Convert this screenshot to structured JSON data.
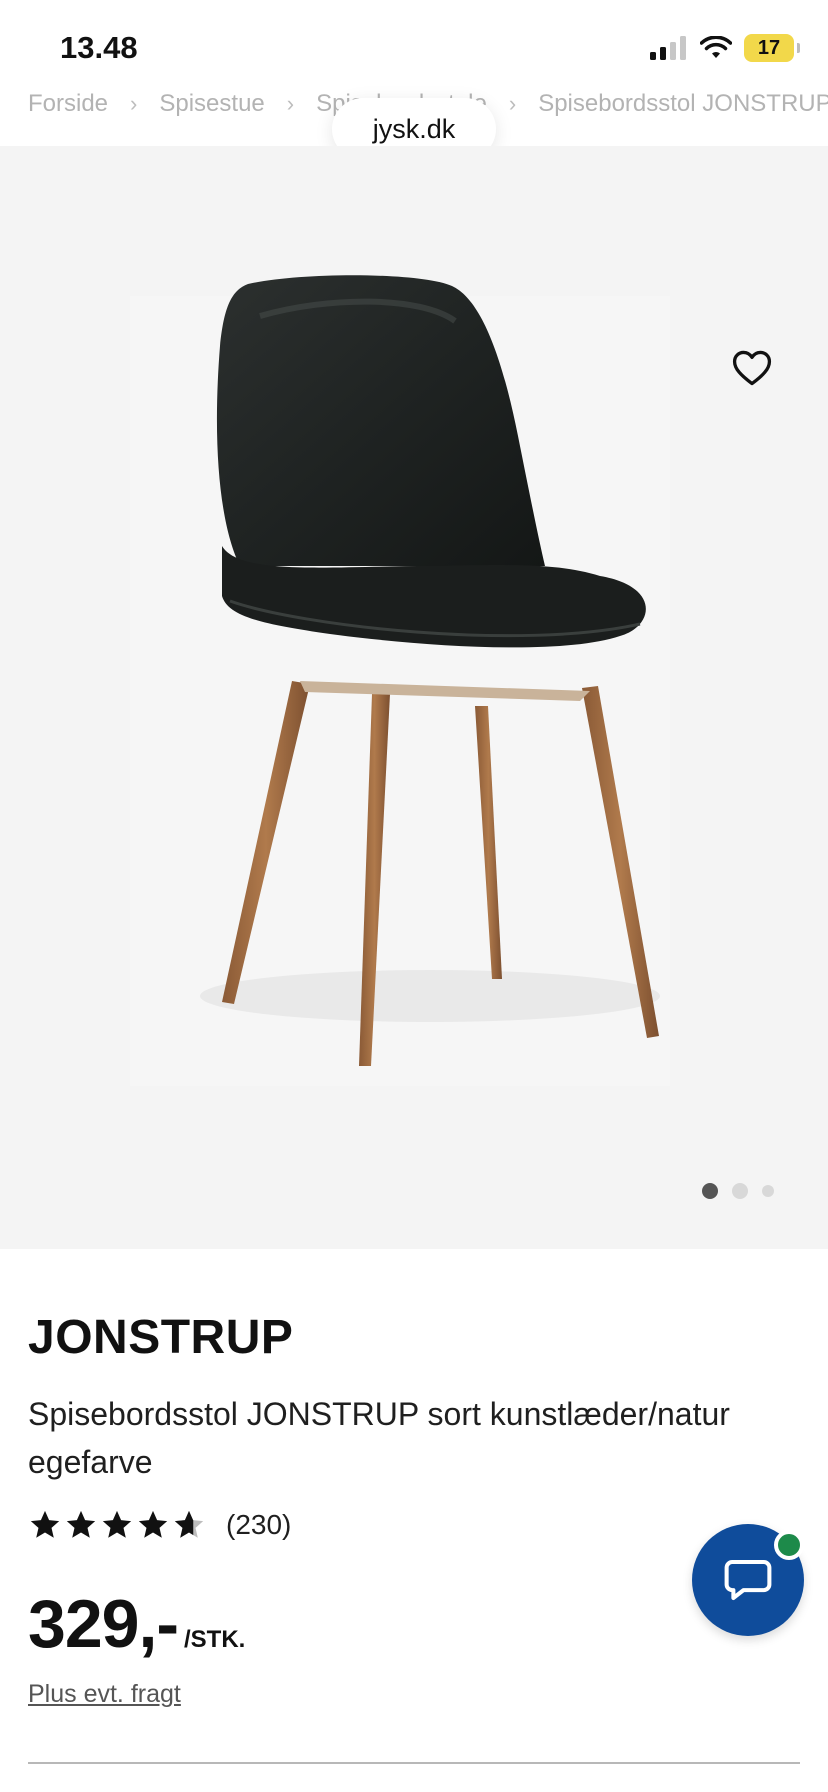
{
  "status_bar": {
    "time": "13.48",
    "battery": "17"
  },
  "breadcrumb": {
    "items": [
      "Forside",
      "Spisestue",
      "Spisebordsstole",
      "Spisebordsstol JONSTRUP"
    ]
  },
  "browser": {
    "url": "jysk.dk"
  },
  "gallery": {
    "image_count": 3,
    "active_index": 0
  },
  "product": {
    "name": "JONSTRUP",
    "description": "Spisebordsstol JONSTRUP sort kunstlæder/natur egefarve",
    "rating": {
      "stars": 4.5,
      "count": "(230)"
    },
    "price": {
      "value": "329,-",
      "unit": "/STK."
    },
    "shipping_note": "Plus evt. fragt"
  },
  "colors": {
    "chat_button": "#0f4c9b",
    "online_indicator": "#1d8a4a",
    "battery": "#f2d84a"
  },
  "icons": {
    "wishlist": "heart-icon",
    "chat": "chat-bubble-icon",
    "signal": "signal-icon",
    "wifi": "wifi-icon",
    "star": "star-icon"
  }
}
